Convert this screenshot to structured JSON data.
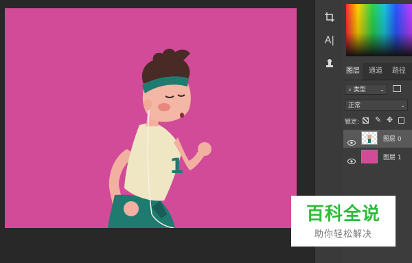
{
  "colors": {
    "canvas_bg": "#d14b99",
    "layer1_fill": "#d14b99",
    "watermark_main": "#2fbb3c"
  },
  "canvas": {
    "jersey_number": "1"
  },
  "toolbar": {
    "tools": [
      "crop-icon",
      "type-icon",
      "stamp-icon"
    ],
    "type_tool_label": "A|"
  },
  "layers_panel": {
    "tabs": [
      {
        "label": "图层",
        "active": true
      },
      {
        "label": "通道",
        "active": false
      },
      {
        "label": "路径",
        "active": false
      }
    ],
    "filter_kind": "类型",
    "blend_mode": "正常",
    "lock_label": "锁定:",
    "layers": [
      {
        "name": "图层 0",
        "selected": true
      },
      {
        "name": "图层 1",
        "selected": false
      }
    ]
  },
  "watermark": {
    "title": "百科全说",
    "subtitle": "助你轻松解决"
  }
}
